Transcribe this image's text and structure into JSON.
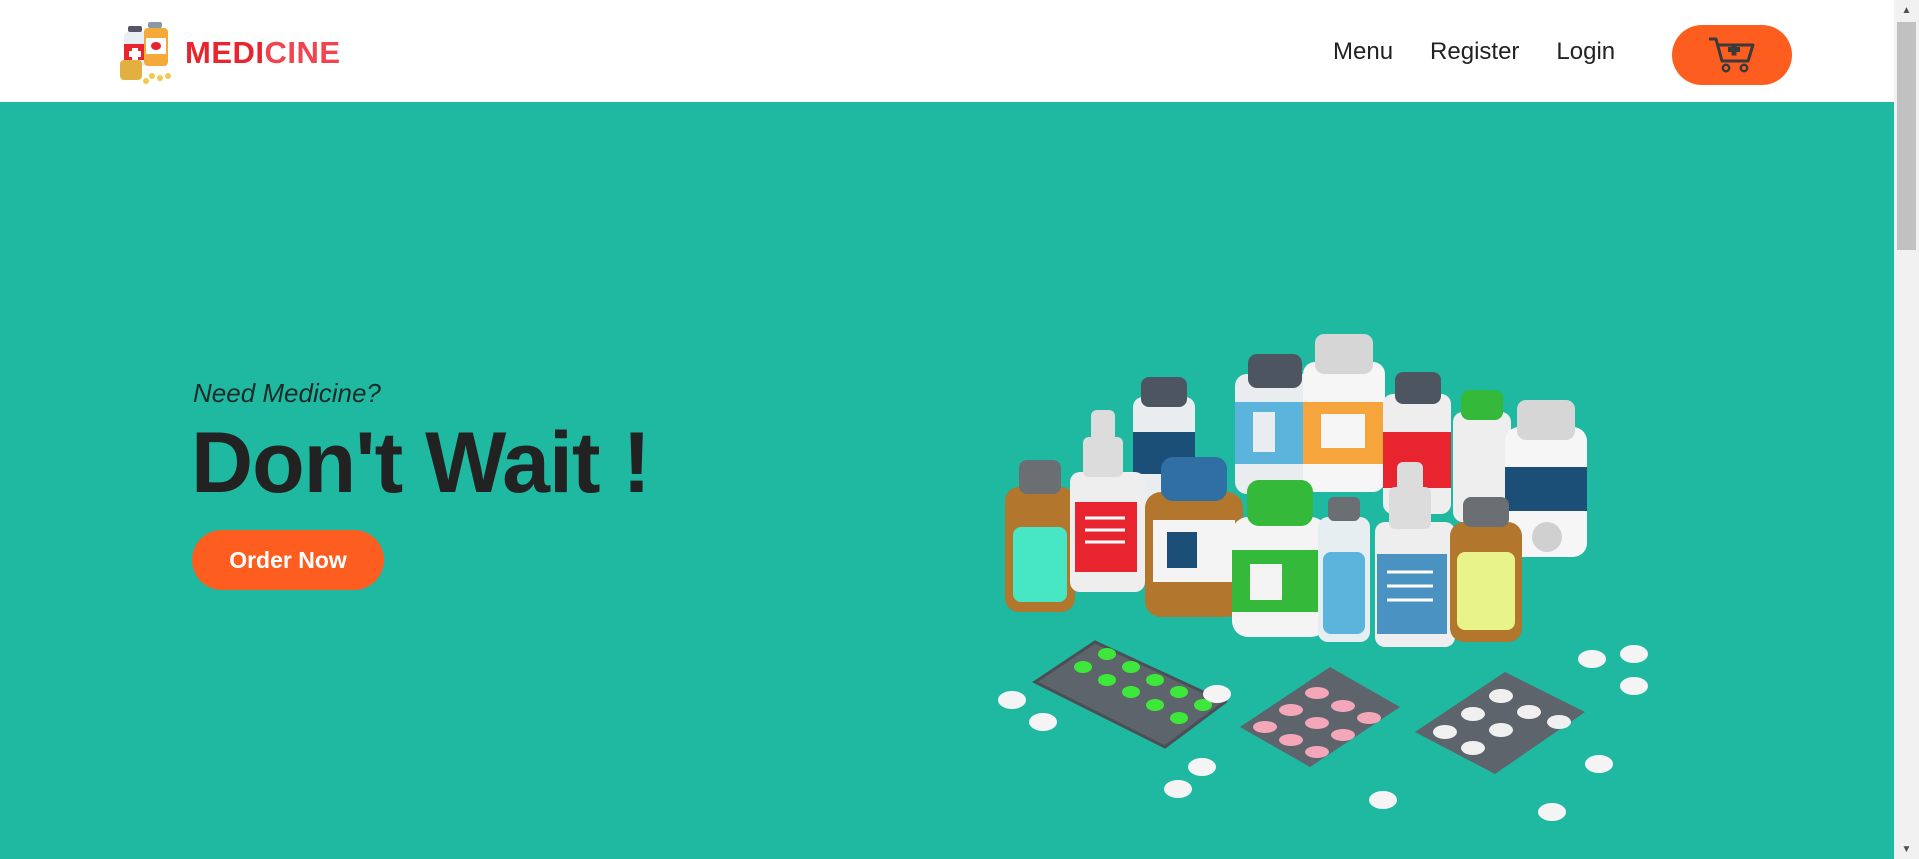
{
  "brand": {
    "name_part1": "MEDI",
    "name_part2": "CINE",
    "logo_icon": "medicine-bottles-logo"
  },
  "nav": {
    "items": [
      "Menu",
      "Register",
      "Login"
    ],
    "cart_icon": "cart-icon"
  },
  "hero": {
    "subtitle": "Need Medicine?",
    "title": "Don't Wait !",
    "cta_label": "Order Now",
    "illustration": "medicine-bottles-and-pills-illustration"
  },
  "colors": {
    "accent": "#fd5e20",
    "hero_bg": "#1fb8a1",
    "brand_red": "#e8252f"
  }
}
